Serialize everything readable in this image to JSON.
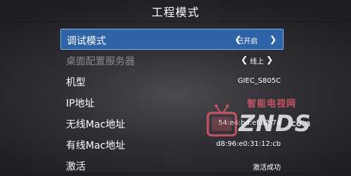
{
  "header": {
    "title": "工程模式"
  },
  "menu": {
    "rows": [
      {
        "label": "调试模式",
        "value": "已开启"
      },
      {
        "label": "桌面配置服务器",
        "value": "线上"
      },
      {
        "label": "机型",
        "value": "GIEC_S805C"
      },
      {
        "label": "IP地址",
        "value": ""
      },
      {
        "label": "无线Mac地址",
        "value": "54:e4:bd:ef:a2:7a"
      },
      {
        "label": "有线Mac地址",
        "value": "d8:96:e0:31:12:cb"
      },
      {
        "label": "激活",
        "value": "激活成功"
      }
    ],
    "selected_index": 0
  },
  "watermark": {
    "tagline": "智能电视网",
    "brand": "ZNDS",
    "domain": ".com"
  },
  "colors": {
    "selection": "#2e63a8",
    "selection_border": "#7fb0e8",
    "dim_text": "#8c8c90",
    "watermark_accent": "#e25a6c"
  },
  "icons": {
    "left_arrow": "chevron-left-icon",
    "right_arrow": "chevron-right-icon",
    "watermark_tv": "tv-icon"
  }
}
